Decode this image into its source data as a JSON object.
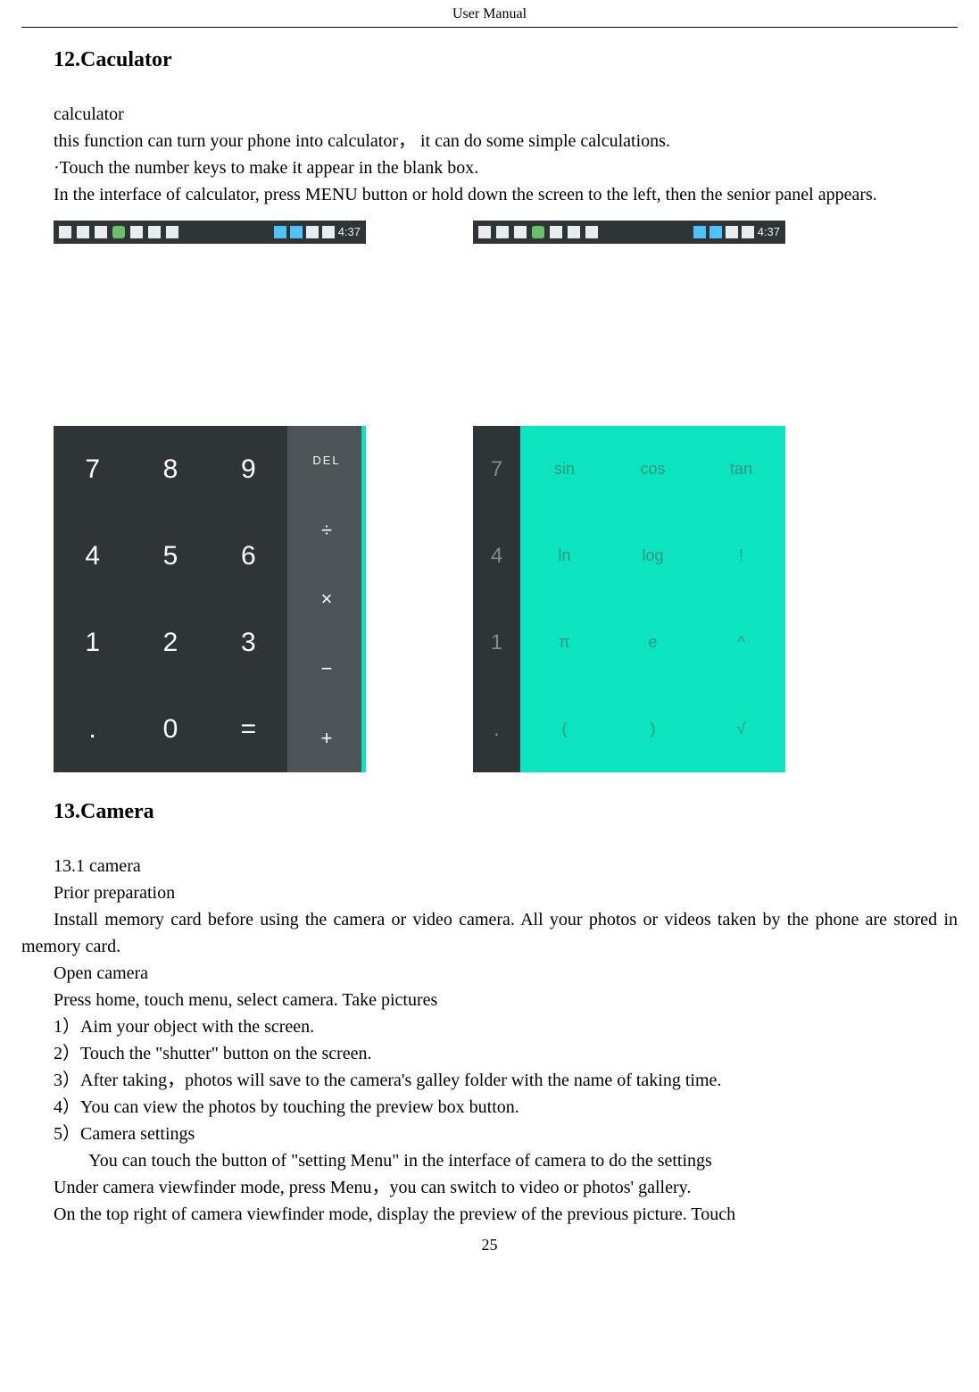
{
  "header": {
    "title": "User    Manual"
  },
  "section12": {
    "heading": "12.Caculator",
    "p1": "calculator",
    "p2": "this function can turn your phone into calculator，  it can do some simple calculations.",
    "p3": "·Touch the number keys to make it appear in the blank box.",
    "p4": "In the interface of calculator, press MENU button or hold down the screen to the left, then the senior panel appears."
  },
  "statusbar": {
    "time": "4:37"
  },
  "calc": {
    "nums": [
      "7",
      "8",
      "9",
      "4",
      "5",
      "6",
      "1",
      "2",
      "3",
      ".",
      "0",
      "="
    ],
    "ops": [
      "DEL",
      "÷",
      "×",
      "−",
      "+"
    ]
  },
  "calc2": {
    "nums": [
      "7",
      "4",
      "1",
      "."
    ],
    "sci": [
      "sin",
      "cos",
      "tan",
      "ln",
      "log",
      "!",
      "π",
      "e",
      "^",
      "(",
      ")",
      "√"
    ]
  },
  "section13": {
    "heading": "13.Camera",
    "p1": "13.1 camera",
    "p2": "Prior preparation",
    "p3": "Install memory card before using the camera or video camera. All your photos or videos taken by the phone are stored in memory card.",
    "p4": "Open camera",
    "p5": "Press home, touch menu, select camera. Take pictures",
    "l1": "1）Aim your object with the screen.",
    "l2": "2）Touch the \"shutter\" button on the screen.",
    "l3": "3）After taking，photos will save to the camera's galley folder with the name of taking time.",
    "l4": "4）You can view the photos by touching the preview box button.",
    "l5": "5）Camera settings",
    "p6": "        You can touch the button of \"setting Menu\" in the interface of camera to do the settings",
    "p7": "Under camera viewfinder mode, press Menu，you can switch to video or photos' gallery.",
    "p8": "On  the  top  right  of  camera  viewfinder  mode,  display  the  preview  of  the  previous  picture.  Touch"
  },
  "pageNumber": "25"
}
